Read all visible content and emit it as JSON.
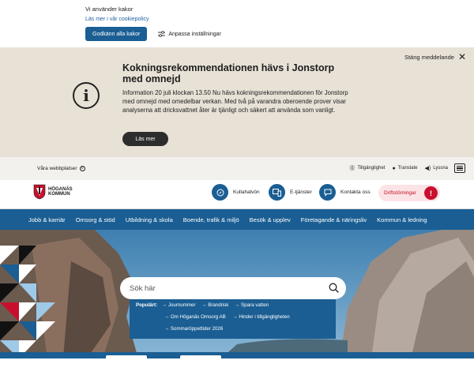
{
  "cookie": {
    "title": "Vi använder kakor",
    "link": "Läs mer i vår cookiepolicy",
    "accept_label": "Godkänn alla kakor",
    "settings_label": "Anpassa inställningar"
  },
  "alert": {
    "close_label": "Stäng meddelande",
    "title": "Kokningsrekommendationen hävs i Jonstorp med omnejd",
    "body": "Information 20 juli klockan 13.50 Nu hävs kokningsrekommendationen för Jonstorp med omnejd med omedelbar verkan. Med två på varandra oberoende prover visar analyserna att dricksvattnet åter är tjänligt och säkert att använda som vanligt.",
    "read_more": "Läs mer"
  },
  "util": {
    "sites": "Våra webbplatser",
    "accessibility": "Tillgänglighet",
    "translate": "Translate",
    "listen": "Lyssna"
  },
  "header": {
    "logo_line1": "HÖGANÄS",
    "logo_line2": "KOMMUN",
    "items": [
      "Kullahalvön",
      "E-tjänster",
      "Kontakta oss"
    ],
    "alert_label": "Driftstörningar"
  },
  "nav": {
    "items": [
      "Jobb & karriär",
      "Omsorg & stöd",
      "Utbildning & skola",
      "Boende, trafik & miljö",
      "Besök & upplev",
      "Företagande & näringsliv",
      "Kommun & ledning"
    ]
  },
  "search": {
    "placeholder": "Sök här",
    "popular_label": "Populärt:",
    "links": [
      "Journummer",
      "Brandrisk",
      "Spara vatten",
      "Om Höganäs Omsorg AB",
      "Hinder i tillgängligheten",
      "Sommaröppettider 2026"
    ]
  },
  "colors": {
    "brand": "#1a5e93",
    "alert_bg": "#e8e1d6",
    "danger": "#c8102e"
  }
}
